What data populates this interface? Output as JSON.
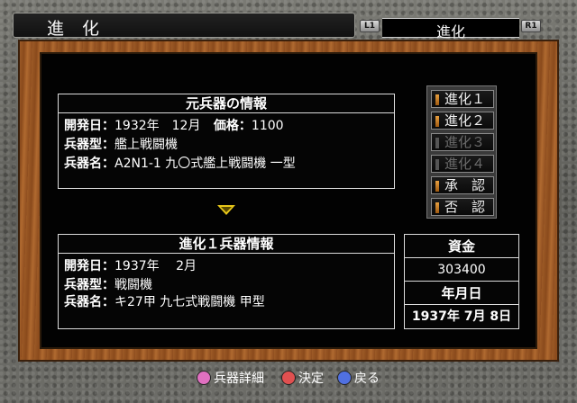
{
  "header": {
    "title": "進化",
    "l1": "L1",
    "r1": "R1",
    "tab_label": "進化"
  },
  "source_weapon": {
    "title": "元兵器の情報",
    "dev_date_label": "開発日：",
    "dev_date_value": "1932年　12月",
    "price_label": "価格：",
    "price_value": "1100",
    "type_label": "兵器型：",
    "type_value": "艦上戦闘機",
    "name_label": "兵器名：",
    "name_value": "A2N1-1 九〇式艦上戦闘機 一型"
  },
  "evolved_weapon": {
    "title": "進化１兵器情報",
    "dev_date_label": "開発日：",
    "dev_date_value": "1937年　 2月",
    "type_label": "兵器型：",
    "type_value": "戦闘機",
    "name_label": "兵器名：",
    "name_value": "キ27甲 九七式戦闘機 甲型"
  },
  "menu": {
    "items": [
      {
        "label": "進化１",
        "enabled": true
      },
      {
        "label": "進化２",
        "enabled": true
      },
      {
        "label": "進化３",
        "enabled": false
      },
      {
        "label": "進化４",
        "enabled": false
      },
      {
        "label": "承　認",
        "enabled": true
      },
      {
        "label": "否　認",
        "enabled": true
      }
    ]
  },
  "funds": {
    "label": "資金",
    "value": "303400",
    "date_label": "年月日",
    "date_value": "1937年  7月  8日"
  },
  "footer": {
    "details_label": "兵器詳細",
    "confirm_label": "決定",
    "back_label": "戻る"
  },
  "colors": {
    "square_button": "#e070c0",
    "circle_button": "#e05050",
    "cross_button": "#5070e0",
    "arrow": "#e8c81a"
  }
}
